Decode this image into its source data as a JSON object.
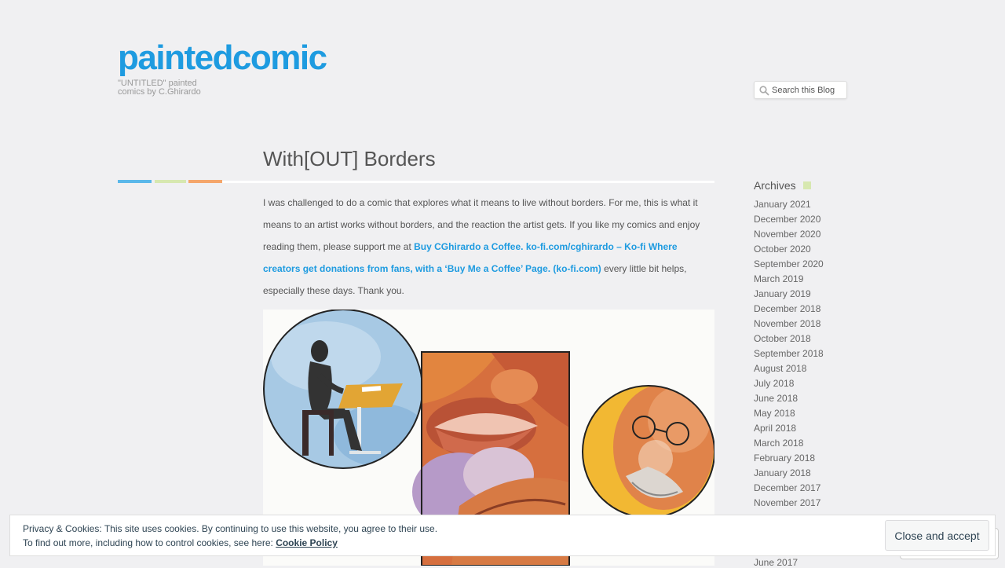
{
  "header": {
    "title": "paintedcomic",
    "tagline_line1": "\"UNTITLED\" painted",
    "tagline_line2": "comics by C.Ghirardo"
  },
  "search": {
    "placeholder": "Search this Blog"
  },
  "post": {
    "title": "With[OUT] Borders",
    "para_start": "I was challenged to do a comic that explores what it means to live without borders. For me, this is what it means to an artist works without borders, and the reaction the artist gets.  If you like my comics and enjoy reading them, please support me at ",
    "link_text": "Buy CGhirardo a Coffee. ko-fi.com/cghirardo – Ko-fi  Where creators get donations from fans, with a ‘Buy Me a Coffee’ Page. (ko-fi.com)",
    "para_end": " every little bit helps, especially these days. Thank you."
  },
  "sidebar": {
    "archives_title": "Archives",
    "archives": [
      "January 2021",
      "December 2020",
      "November 2020",
      "October 2020",
      "September 2020",
      "March 2019",
      "January 2019",
      "December 2018",
      "November 2018",
      "October 2018",
      "September 2018",
      "August 2018",
      "July 2018",
      "June 2018",
      "May 2018",
      "April 2018",
      "March 2018",
      "February 2018",
      "January 2018",
      "December 2017",
      "November 2017"
    ],
    "archive_peek": "June 2017"
  },
  "cookie": {
    "line1": "Privacy & Cookies: This site uses cookies. By continuing to use this website, you agree to their use.",
    "line2_prefix": "To find out more, including how to control cookies, see here: ",
    "policy_link": "Cookie Policy",
    "button": "Close and accept"
  },
  "colors": {
    "brand": "#1e9be0",
    "accent_blue": "#5bb8ea",
    "accent_green": "#d7e8b0",
    "accent_orange": "#f5a66b",
    "background": "#f0f0f2"
  }
}
